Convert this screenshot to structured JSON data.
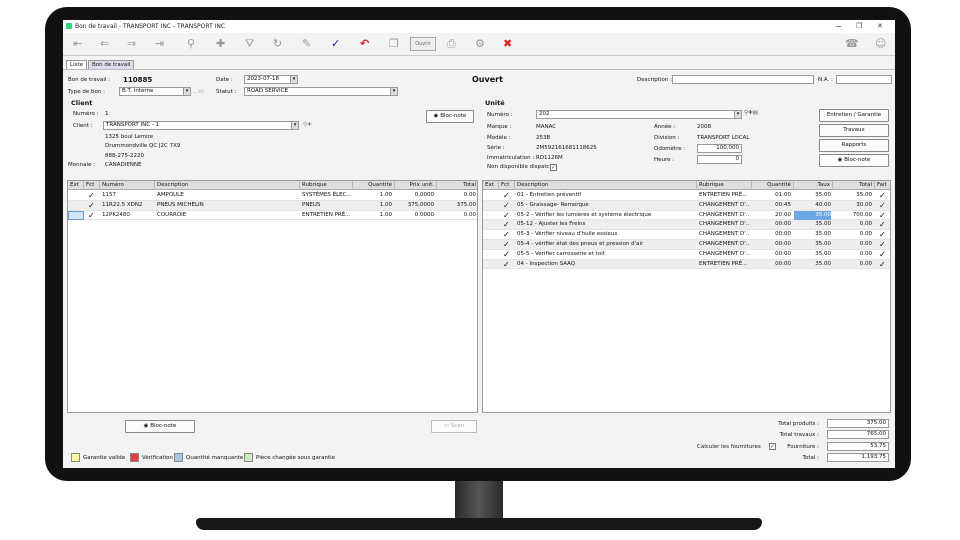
{
  "window": {
    "title": "Bon de travail - TRANSPORT INC - TRANSPORT INC"
  },
  "toolbar": {
    "open_label": "Ouvrir"
  },
  "tabs": [
    {
      "label": "Liste"
    },
    {
      "label": "Bon de travail"
    }
  ],
  "header": {
    "bon_label": "Bon de travail :",
    "bon_value": "110885",
    "type_label": "Type de bon :",
    "type_value": "B.T. Interne",
    "date_label": "Date :",
    "date_value": "2023-07-18",
    "statut_label": "Statut :",
    "statut_value": "ROAD SERVICE",
    "status_text": "Ouvert",
    "description_label": "Description :",
    "description_value": "",
    "na_label": "N.A. :",
    "na_value": ""
  },
  "client": {
    "section_title": "Client",
    "numero_label": "Numéro :",
    "numero_value": "1",
    "client_label": "Client :",
    "client_value": "TRANSPORT INC - 1",
    "address1": "1325 boul Lemire",
    "address2": "Drummondville QC  J2C 7X9",
    "phone": "888-275-2220",
    "monnaie_label": "Monnaie :",
    "monnaie_value": "CANADIENNE",
    "bloc_note": "Bloc-note"
  },
  "unit": {
    "section_title": "Unité",
    "numero_label": "Numéro :",
    "numero_value": "202",
    "marque_label": "Marque :",
    "marque_value": "MANAC",
    "modele_label": "Modèle :",
    "modele_value": "253B",
    "serie_label": "Série :",
    "serie_value": "2M592161681118625",
    "immat_label": "Immatriculation :",
    "immat_value": "RD1126M",
    "dispatch_label": "Non disponible dispatch",
    "annee_label": "Année :",
    "annee_value": "2008",
    "division_label": "Division :",
    "division_value": "TRANSPORT LOCAL",
    "odometre_label": "Odomètre :",
    "odometre_value": "100,000",
    "heure_label": "Heure :",
    "heure_value": "0"
  },
  "side_buttons": {
    "entretien": "Entretien / Garantie",
    "travaux": "Travaux",
    "rapports": "Rapports",
    "bloc_note": "Bloc-note"
  },
  "parts_table": {
    "headers": [
      "Ext",
      "Fct",
      "Numéro",
      "Description",
      "Rubrique",
      "Quantité",
      "Prix unit.",
      "Total"
    ],
    "rows": [
      {
        "check": "✓",
        "numero": "1157",
        "description": "AMPOULE",
        "rubrique": "SYSTÈMES ÉLEC...",
        "quantite": "1.00",
        "prix": "0.0000",
        "total": "0.00"
      },
      {
        "check": "✓",
        "numero": "11R22.5 XDN2",
        "description": "PNEUS MICHELIN",
        "rubrique": "PNEUS",
        "quantite": "1.00",
        "prix": "375.0000",
        "total": "375.00"
      },
      {
        "check": "✓",
        "numero": "12PK2480",
        "description": "COURROIE",
        "rubrique": "ENTRETIEN PRÉ...",
        "quantite": "1.00",
        "prix": "0.0000",
        "total": "0.00"
      }
    ]
  },
  "labor_table": {
    "headers": [
      "Ext",
      "Fct",
      "Description",
      "Rubrique",
      "Quantité",
      "Taux",
      "Total",
      "Fait"
    ],
    "rows": [
      {
        "check": "✓",
        "description": "01 - Entretien préventif",
        "rubrique": "ENTRETIEN PRÉ...",
        "quantite": "01:00",
        "taux": "35.00",
        "total": "35.00",
        "fait": "✓"
      },
      {
        "check": "✓",
        "description": "05 - Graissage- Remorque",
        "rubrique": "CHANGEMENT D'...",
        "quantite": "00:45",
        "taux": "40.00",
        "total": "30.00",
        "fait": "✓"
      },
      {
        "check": "✓",
        "description": "05-2 - Vérifier les lumières et système électrique",
        "rubrique": "CHANGEMENT D'...",
        "quantite": "20:00",
        "taux": "35.00",
        "total": "700.00",
        "fait": "✓"
      },
      {
        "check": "✓",
        "description": "05-12 - Ajuster les Freins",
        "rubrique": "CHANGEMENT D'...",
        "quantite": "00:00",
        "taux": "35.00",
        "total": "0.00",
        "fait": "✓"
      },
      {
        "check": "✓",
        "description": "05-3 - Vérifier niveau d'huile essieux",
        "rubrique": "CHANGEMENT D'...",
        "quantite": "00:00",
        "taux": "35.00",
        "total": "0.00",
        "fait": "✓"
      },
      {
        "check": "✓",
        "description": "05-4 - vérifier état des pneus et pression d'air",
        "rubrique": "CHANGEMENT D'...",
        "quantite": "00:00",
        "taux": "35.00",
        "total": "0.00",
        "fait": "✓"
      },
      {
        "check": "✓",
        "description": "05-5 - Vérifier carrosserie et toit",
        "rubrique": "CHANGEMENT D'...",
        "quantite": "00:00",
        "taux": "35.00",
        "total": "0.00",
        "fait": "✓"
      },
      {
        "check": "✓",
        "description": "04 - Inspection SAAQ",
        "rubrique": "ENTRETIEN PRÉ...",
        "quantite": "00:00",
        "taux": "35.00",
        "total": "0.00",
        "fait": "✓"
      }
    ]
  },
  "bottom": {
    "bloc_note": "Bloc-note",
    "scan": "Scan",
    "calc_label": "Calculer les fournitures",
    "total_produits_label": "Total produits :",
    "total_produits": "375.00",
    "total_travaux_label": "Total travaux :",
    "total_travaux": "765.00",
    "fourniture_label": "Fourniture :",
    "fourniture": "53.75",
    "total_label": "Total :",
    "total": "1,193.75"
  },
  "legend": [
    {
      "label": "Garantie valide",
      "color": "#fff8a0"
    },
    {
      "label": "Vérification",
      "color": "#e04040"
    },
    {
      "label": "Quantité manquante",
      "color": "#a9c4ea"
    },
    {
      "label": "Pièce changée sous garantie",
      "color": "#cfe8c4"
    }
  ]
}
